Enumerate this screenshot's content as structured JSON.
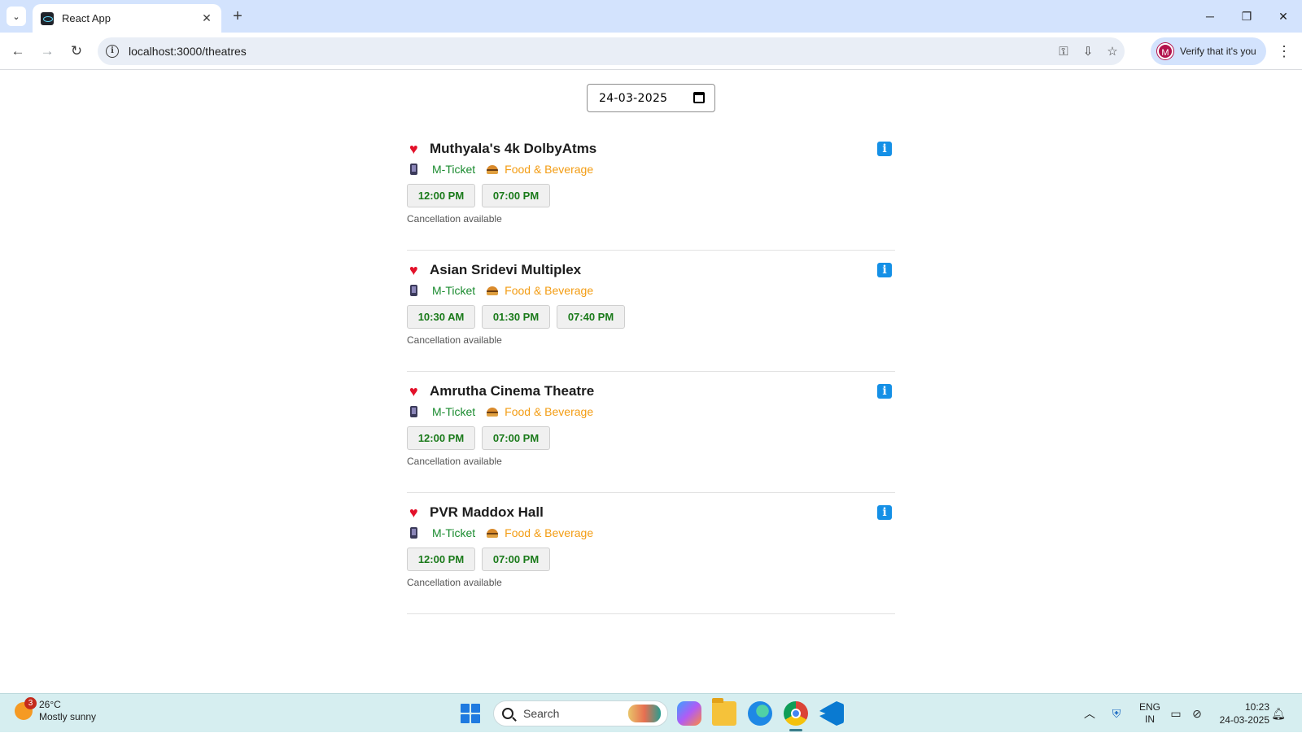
{
  "browser": {
    "tab_title": "React App",
    "tab_close": "✕",
    "new_tab": "+",
    "url": "localhost:3000/theatres",
    "verify_label": "Verify that it's you",
    "avatar_letter": "M"
  },
  "date_picker": {
    "value": "24-03-2025"
  },
  "theatres": [
    {
      "name": "Muthyala's 4k DolbyAtms",
      "m_ticket": "M-Ticket",
      "food": "Food & Beverage",
      "showtimes": [
        "12:00 PM",
        "07:00 PM"
      ],
      "note": "Cancellation available"
    },
    {
      "name": "Asian Sridevi Multiplex",
      "m_ticket": "M-Ticket",
      "food": "Food & Beverage",
      "showtimes": [
        "10:30 AM",
        "01:30 PM",
        "07:40 PM"
      ],
      "note": "Cancellation available"
    },
    {
      "name": "Amrutha Cinema Theatre",
      "m_ticket": "M-Ticket",
      "food": "Food & Beverage",
      "showtimes": [
        "12:00 PM",
        "07:00 PM"
      ],
      "note": "Cancellation available"
    },
    {
      "name": "PVR Maddox Hall",
      "m_ticket": "M-Ticket",
      "food": "Food & Beverage",
      "showtimes": [
        "12:00 PM",
        "07:00 PM"
      ],
      "note": "Cancellation available"
    }
  ],
  "taskbar": {
    "weather_temp": "26°C",
    "weather_desc": "Mostly sunny",
    "weather_badge": "3",
    "search_label": "Search",
    "lang_top": "ENG",
    "lang_bottom": "IN",
    "time": "10:23",
    "date": "24-03-2025"
  },
  "colors": {
    "accent_info": "#1590e6",
    "showtime_text": "#1a7a1a",
    "m_ticket_text": "#1a8b2f",
    "food_text": "#f39c12",
    "heart": "#e3112a"
  }
}
